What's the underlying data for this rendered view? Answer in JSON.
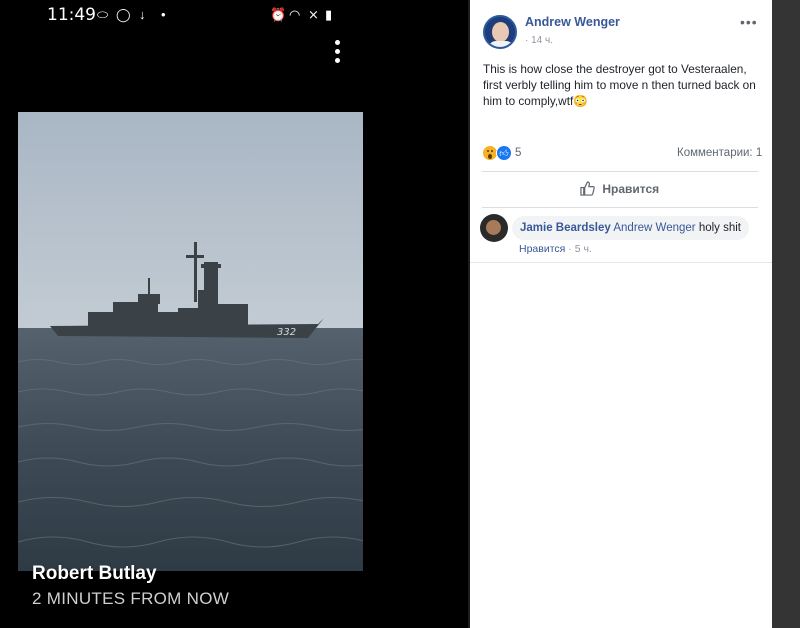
{
  "phone": {
    "status_time": "11:49",
    "status_icons": [
      "messenger-icon",
      "whatsapp-icon",
      "download-icon",
      "dot-icon",
      "alarm-icon",
      "wifi-icon",
      "mute-icon",
      "battery-icon"
    ],
    "poster_name": "Robert Butlay",
    "time_ago": "2 MINUTES FROM NOW",
    "photo_hull_number": "332"
  },
  "post": {
    "author": "Andrew Wenger",
    "time": "14 ч.",
    "separator": "·",
    "text": "This is how close the destroyer got to Vesteraalen, first verbly telling him to move n then turned back on him to comply,wtf😳",
    "reaction_count": "5",
    "comments_label": "Комментарии: 1",
    "like_button_label": "Нравится"
  },
  "comment": {
    "author": "Jamie Beardsley",
    "mention": "Andrew Wenger",
    "text": "holy shit",
    "like_label": "Нравится",
    "time": "5 ч."
  },
  "colors": {
    "link_blue": "#385898",
    "muted_gray": "#606770",
    "like_blue": "#1877f2",
    "wow_yellow": "#f7b125"
  }
}
